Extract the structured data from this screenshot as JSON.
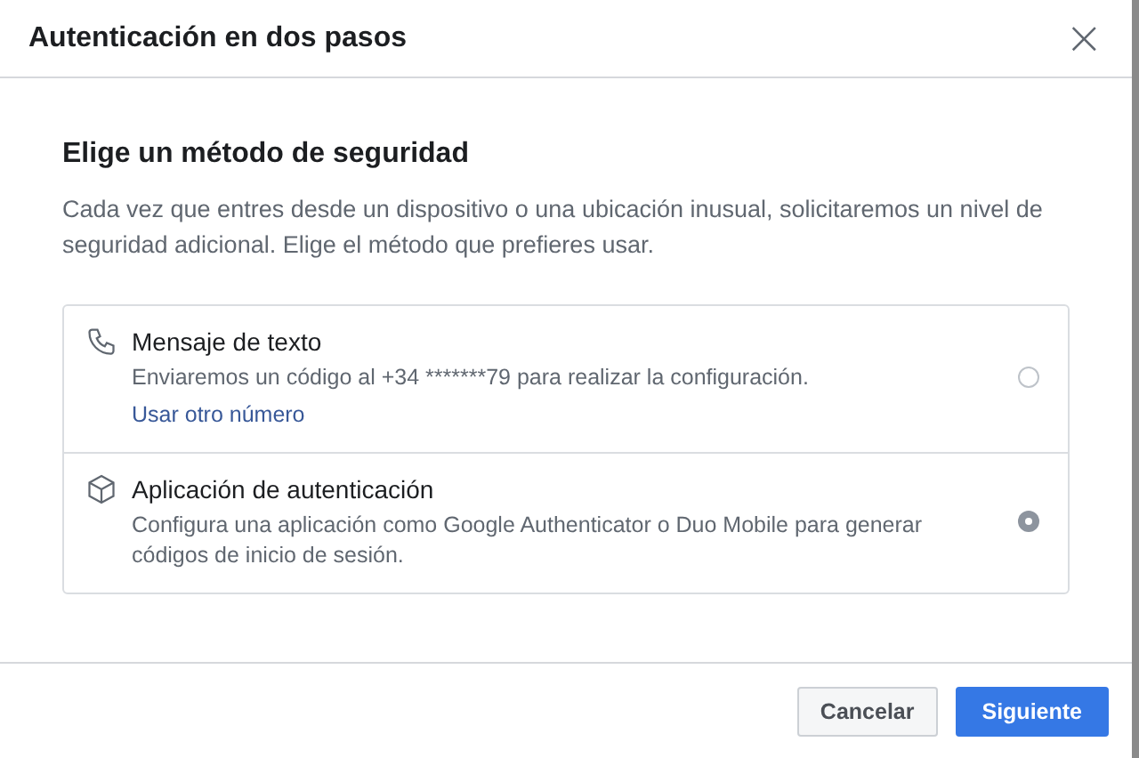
{
  "dialog": {
    "title": "Autenticación en dos pasos",
    "close": "×"
  },
  "heading": "Elige un método de seguridad",
  "description": "Cada vez que entres desde un dispositivo o una ubicación inusual, solicitaremos un nivel de seguridad adicional. Elige el método que prefieres usar.",
  "methods": [
    {
      "kind": "phone",
      "title": "Mensaje de texto",
      "text": "Enviaremos un código al +34 *******79 para realizar la configuración.",
      "link": "Usar otro número",
      "selected": false
    },
    {
      "kind": "app",
      "title": "Aplicación de autenticación",
      "text": "Configura una aplicación como Google Authenticator o Duo Mobile para generar códigos de inicio de sesión.",
      "selected": true
    }
  ],
  "buttons": [
    {
      "kind": "secondary",
      "label": "Cancelar"
    },
    {
      "kind": "primary",
      "label": "Siguiente"
    }
  ]
}
